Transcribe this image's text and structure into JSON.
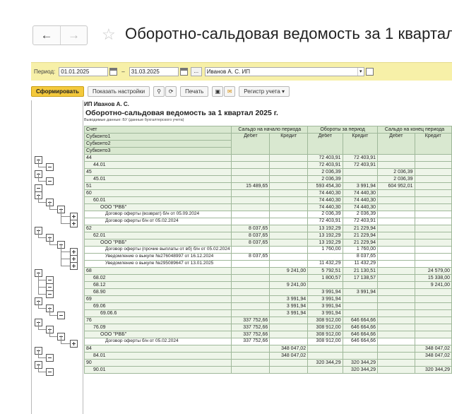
{
  "window": {
    "title": "Оборотно-сальдовая ведомость за 1 квартал",
    "back_icon": "←",
    "forward_icon": "→",
    "star_icon": "☆"
  },
  "period_bar": {
    "label": "Период:",
    "date_from": "01.01.2025",
    "dash": "–",
    "date_to": "31.03.2025",
    "ellipsis": "...",
    "org": "Иванов А. С. ИП"
  },
  "toolbar": {
    "generate": "Сформировать",
    "settings": "Показать настройки",
    "print": "Печать",
    "register": "Регистр учета"
  },
  "report": {
    "org": "ИП Иванов А. С.",
    "title": "Оборотно-сальдовая ведомость за 1 квартал 2025 г.",
    "subtitle": "Выводимые данные: БУ (данные бухгалтерского учета)",
    "headers": {
      "account": "Счет",
      "opening": "Сальдо на начало периода",
      "turnover": "Обороты за период",
      "closing": "Сальдо на конец периода",
      "debit": "Дебет",
      "credit": "Кредит",
      "sub1": "Субконто1",
      "sub2": "Субконто2",
      "sub3": "Субконто3"
    },
    "rows": [
      {
        "name": "44",
        "ind": 0,
        "od": "",
        "oc": "",
        "td": "72 403,91",
        "tc": "72 403,91",
        "cd": "",
        "cc": "",
        "cls": "grn"
      },
      {
        "name": "44.01",
        "ind": 1,
        "od": "",
        "oc": "",
        "td": "72 403,91",
        "tc": "72 403,91",
        "cd": "",
        "cc": "",
        "cls": "grn"
      },
      {
        "name": "45",
        "ind": 0,
        "od": "",
        "oc": "",
        "td": "2 036,39",
        "tc": "",
        "cd": "2 036,39",
        "cc": "",
        "cls": "grn"
      },
      {
        "name": "45.01",
        "ind": 1,
        "od": "",
        "oc": "",
        "td": "2 036,39",
        "tc": "",
        "cd": "2 036,39",
        "cc": "",
        "cls": "grn"
      },
      {
        "name": "51",
        "ind": 0,
        "od": "15 489,65",
        "oc": "",
        "td": "593 454,30",
        "tc": "3 991,94",
        "cd": "604 952,01",
        "cc": "",
        "cls": "grn"
      },
      {
        "name": "60",
        "ind": 0,
        "od": "",
        "oc": "",
        "td": "74 440,30",
        "tc": "74 440,30",
        "cd": "",
        "cc": "",
        "cls": "grn"
      },
      {
        "name": "60.01",
        "ind": 1,
        "od": "",
        "oc": "",
        "td": "74 440,30",
        "tc": "74 440,30",
        "cd": "",
        "cc": "",
        "cls": "grn"
      },
      {
        "name": "ООО \"РВБ\"",
        "ind": 2,
        "od": "",
        "oc": "",
        "td": "74 440,30",
        "tc": "74 440,30",
        "cd": "",
        "cc": "",
        "cls": "grn"
      },
      {
        "name": "Договор оферты (возврат) б/н от 05.09.2024",
        "ind": 3,
        "od": "",
        "oc": "",
        "td": "2 036,39",
        "tc": "2 036,39",
        "cd": "",
        "cc": "",
        "cls": "wht",
        "h": "med"
      },
      {
        "name": "Договор оферты б/н от 05.02.2024",
        "ind": 3,
        "od": "",
        "oc": "",
        "td": "72 403,91",
        "tc": "72 403,91",
        "cd": "",
        "cc": "",
        "cls": "wht",
        "h": "med"
      },
      {
        "name": "62",
        "ind": 0,
        "od": "8 037,65",
        "oc": "",
        "td": "13 192,29",
        "tc": "21 229,94",
        "cd": "",
        "cc": "",
        "cls": "grn"
      },
      {
        "name": "62.01",
        "ind": 1,
        "od": "8 037,65",
        "oc": "",
        "td": "13 192,29",
        "tc": "21 229,94",
        "cd": "",
        "cc": "",
        "cls": "grn"
      },
      {
        "name": "ООО \"РВБ\"",
        "ind": 2,
        "od": "8 037,65",
        "oc": "",
        "td": "13 192,29",
        "tc": "21 229,94",
        "cd": "",
        "cc": "",
        "cls": "grn"
      },
      {
        "name": "Договор оферты (прочие выплаты от вб) б/н от 05.02.2024",
        "ind": 3,
        "od": "",
        "oc": "",
        "td": "1 760,00",
        "tc": "1 760,00",
        "cd": "",
        "cc": "",
        "cls": "wht",
        "h": "tall"
      },
      {
        "name": "Уведомление о выкупе №276048997 от 16.12.2024",
        "ind": 3,
        "od": "8 037,65",
        "oc": "",
        "td": "",
        "tc": "8 037,65",
        "cd": "",
        "cc": "",
        "cls": "wht",
        "h": "med"
      },
      {
        "name": "Уведомление о выкупе №295089647 от 13.01.2025",
        "ind": 3,
        "od": "",
        "oc": "",
        "td": "11 432,29",
        "tc": "11 432,29",
        "cd": "",
        "cc": "",
        "cls": "wht",
        "h": "med"
      },
      {
        "name": "68",
        "ind": 0,
        "od": "",
        "oc": "9 241,00",
        "td": "5 792,51",
        "tc": "21 130,51",
        "cd": "",
        "cc": "24 579,00",
        "cls": "grn"
      },
      {
        "name": "68.02",
        "ind": 1,
        "od": "",
        "oc": "",
        "td": "1 800,57",
        "tc": "17 138,57",
        "cd": "",
        "cc": "15 338,00",
        "cls": "grn"
      },
      {
        "name": "68.12",
        "ind": 1,
        "od": "",
        "oc": "9 241,00",
        "td": "",
        "tc": "",
        "cd": "",
        "cc": "9 241,00",
        "cls": "grn"
      },
      {
        "name": "68.90",
        "ind": 1,
        "od": "",
        "oc": "",
        "td": "3 991,94",
        "tc": "3 991,94",
        "cd": "",
        "cc": "",
        "cls": "grn"
      },
      {
        "name": "69",
        "ind": 0,
        "od": "",
        "oc": "3 991,94",
        "td": "3 991,94",
        "tc": "",
        "cd": "",
        "cc": "",
        "cls": "grn"
      },
      {
        "name": "69.06",
        "ind": 1,
        "od": "",
        "oc": "3 991,94",
        "td": "3 991,94",
        "tc": "",
        "cd": "",
        "cc": "",
        "cls": "grn"
      },
      {
        "name": "69.06.6",
        "ind": 2,
        "od": "",
        "oc": "3 991,94",
        "td": "3 991,94",
        "tc": "",
        "cd": "",
        "cc": "",
        "cls": "grn"
      },
      {
        "name": "76",
        "ind": 0,
        "od": "337 752,66",
        "oc": "",
        "td": "308 912,00",
        "tc": "646 664,66",
        "cd": "",
        "cc": "",
        "cls": "grn"
      },
      {
        "name": "76.09",
        "ind": 1,
        "od": "337 752,66",
        "oc": "",
        "td": "308 912,00",
        "tc": "646 664,66",
        "cd": "",
        "cc": "",
        "cls": "grn"
      },
      {
        "name": "ООО \"РВБ\"",
        "ind": 2,
        "od": "337 752,66",
        "oc": "",
        "td": "308 912,00",
        "tc": "646 664,66",
        "cd": "",
        "cc": "",
        "cls": "grn"
      },
      {
        "name": "Договор оферты б/н от 05.02.2024",
        "ind": 3,
        "od": "337 752,66",
        "oc": "",
        "td": "308 912,00",
        "tc": "646 664,66",
        "cd": "",
        "cc": "",
        "cls": "wht",
        "h": "med"
      },
      {
        "name": "84",
        "ind": 0,
        "od": "",
        "oc": "348 047,02",
        "td": "",
        "tc": "",
        "cd": "",
        "cc": "348 047,02",
        "cls": "grn"
      },
      {
        "name": "84.01",
        "ind": 1,
        "od": "",
        "oc": "348 047,02",
        "td": "",
        "tc": "",
        "cd": "",
        "cc": "348 047,02",
        "cls": "grn"
      },
      {
        "name": "90",
        "ind": 0,
        "od": "",
        "oc": "",
        "td": "320 344,29",
        "tc": "320 344,29",
        "cd": "",
        "cc": "",
        "cls": "grn"
      },
      {
        "name": "90.01",
        "ind": 1,
        "od": "",
        "oc": "",
        "td": "",
        "tc": "320 344,29",
        "cd": "",
        "cc": "320 344,29",
        "cls": "grn"
      }
    ]
  }
}
